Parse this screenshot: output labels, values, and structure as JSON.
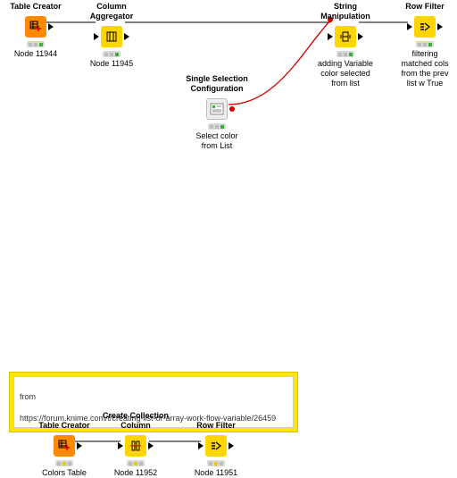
{
  "nodes": {
    "tableCreator1": {
      "title": "Table Creator",
      "caption": "Node 11944"
    },
    "columnAggregator": {
      "title": "Column Aggregator",
      "caption": "Node 11945"
    },
    "stringManipulation": {
      "title": "String Manipulation",
      "caption": "adding Variable\ncolor selected\nfrom list"
    },
    "rowFilter1": {
      "title": "Row Filter",
      "caption": "filtering\nmatched cols\nfrom the prev\nlist w True"
    },
    "singleSelConf": {
      "title": "Single Selection\nConfiguration",
      "caption": "Select color\nfrom List"
    },
    "tableCreator2": {
      "title": "Table Creator",
      "caption": "Colors Table"
    },
    "createCollCol": {
      "title": "Create Collection\nColumn",
      "caption": "Node 11952"
    },
    "rowFilter2": {
      "title": "Row Filter",
      "caption": "Node 11951"
    }
  },
  "note": {
    "line1": "from",
    "line2": "https://forum.knime.com/t/creating-list-or-array-work-flow-variable/26459"
  },
  "colors": {
    "orange": "#ff8a00",
    "yellow": "#ffd500",
    "lightgrey": "#eeeeee"
  }
}
